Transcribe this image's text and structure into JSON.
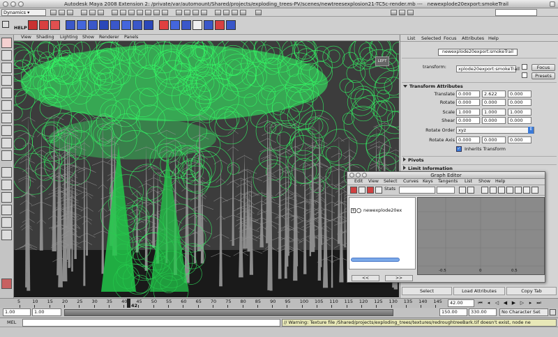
{
  "window": {
    "title": "Autodesk Maya 2008 Extension 2: /private/var/automount/Shared/projects/exploding_trees-PV/scenes/newtreesexplosion21-TC5c-render.mb",
    "title_separator": "---",
    "selected_object": "newexplode20export:smokeTrail"
  },
  "status_line": {
    "mode": "Dynamics"
  },
  "shelf": {
    "help_label": "HELP"
  },
  "viewport": {
    "menu": [
      "View",
      "Shading",
      "Lighting",
      "Show",
      "Renderer",
      "Panels"
    ],
    "camera_label": "LEFT"
  },
  "attribute_editor": {
    "menu": [
      "List",
      "Selected",
      "Focus",
      "Attributes",
      "Help"
    ],
    "node_tab": "newexplode20export:smokeTrail",
    "transform_label": "transform:",
    "transform_value": "xplode20export:smokeTrail",
    "focus_button": "Focus",
    "presets_button": "Presets",
    "section_transform": "Transform Attributes",
    "translate_label": "Translate",
    "translate": [
      "0.000",
      "2.622",
      "0.000"
    ],
    "rotate_label": "Rotate",
    "rotate": [
      "0.000",
      "0.000",
      "0.000"
    ],
    "scale_label": "Scale",
    "scale": [
      "1.000",
      "1.000",
      "1.000"
    ],
    "shear_label": "Shear",
    "shear": [
      "0.000",
      "0.000",
      "0.000"
    ],
    "rotate_order_label": "Rotate Order",
    "rotate_order": "xyz",
    "rotate_axis_label": "Rotate Axis",
    "rotate_axis": [
      "0.000",
      "0.000",
      "0.000"
    ],
    "inherits_transform": "Inherits Transform",
    "section_pivots": "Pivots",
    "section_limit": "Limit Information",
    "select_button": "Select",
    "load_attributes_button": "Load Attributes",
    "copy_tab_button": "Copy Tab"
  },
  "graph_editor": {
    "title": "Graph Editor",
    "menu": [
      "Edit",
      "View",
      "Select",
      "Curves",
      "Keys",
      "Tangents",
      "List",
      "Show",
      "Help"
    ],
    "stats_label": "Stats",
    "outliner_item": "newexplode20ex",
    "prev_button": "<<",
    "next_button": ">>",
    "axis_labels": [
      "-0.5",
      "0",
      "0.5"
    ]
  },
  "time_slider": {
    "ticks": [
      "5",
      "10",
      "15",
      "20",
      "25",
      "30",
      "35",
      "40",
      "45",
      "50",
      "55",
      "60",
      "65",
      "70",
      "75",
      "80",
      "85",
      "90",
      "95",
      "100",
      "105",
      "110",
      "115",
      "120",
      "125",
      "130",
      "135",
      "140",
      "145"
    ],
    "current_frame_marker": "42",
    "current_frame": "42.00"
  },
  "range_slider": {
    "start_time": "1.00",
    "playback_start": "1.00",
    "playback_end": "150.00",
    "end_time": "330.00",
    "character_set": "No Character Set"
  },
  "command_line": {
    "mel_label": "MEL",
    "warning": "// Warning: Texture file /Shared/projects/exploding_trees/textures/redroughtreeBark.tif doesn't exist, node ne"
  },
  "colors": {
    "particle_green": "#33ff66",
    "tree_grey": "#8c8c8c",
    "selection_blue": "#3a57c9",
    "warning_bg": "#e8e8b8"
  }
}
